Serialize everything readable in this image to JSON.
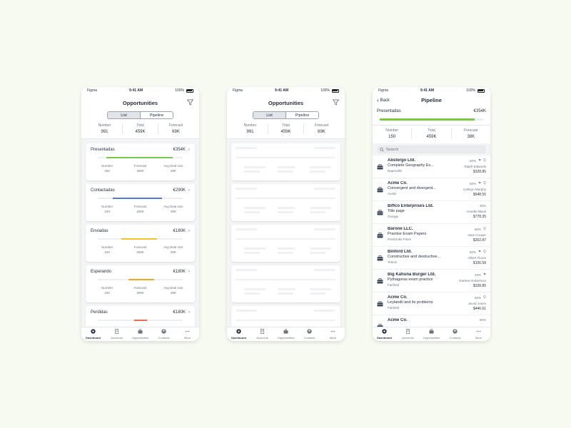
{
  "status": {
    "carrier": "Figma",
    "time": "9:41 AM",
    "battery": "100%"
  },
  "screen1": {
    "title": "Opportunities",
    "segments": [
      "List",
      "Pipeline"
    ],
    "stats": [
      {
        "label": "Number",
        "value": "991"
      },
      {
        "label": "Total",
        "value": "459K"
      },
      {
        "label": "Forecast",
        "value": "69K"
      }
    ],
    "mini_labels": [
      "Number",
      "Forecast",
      "Avg Deal size"
    ],
    "cards": [
      {
        "name": "Presentadas",
        "amount": "€354K",
        "color": "#7ac943",
        "progress": 0.78,
        "offset": 0.1,
        "number": "150",
        "forecast": "459K",
        "avg": "38K"
      },
      {
        "name": "Contactadas",
        "amount": "€290K",
        "color": "#4a7fd4",
        "progress": 0.58,
        "offset": 0.18,
        "number": "150",
        "forecast": "459K",
        "avg": "38K"
      },
      {
        "name": "Enviadas",
        "amount": "€180K",
        "color": "#f2c12e",
        "progress": 0.42,
        "offset": 0.28,
        "number": "150",
        "forecast": "459K",
        "avg": "38K"
      },
      {
        "name": "Esperando",
        "amount": "€180K",
        "color": "#f5a623",
        "progress": 0.3,
        "offset": 0.36,
        "number": "150",
        "forecast": "459K",
        "avg": "38K"
      },
      {
        "name": "Perdidas",
        "amount": "€180K",
        "color": "#f0684b",
        "progress": 0.15,
        "offset": 0.43
      }
    ]
  },
  "screen2": {
    "title": "Opportunities",
    "segments": [
      "List",
      "Pipeline"
    ],
    "stats": [
      {
        "label": "Number",
        "value": "991"
      },
      {
        "label": "Total",
        "value": "459K"
      },
      {
        "label": "Forecast",
        "value": "69K"
      }
    ]
  },
  "screen3": {
    "back": "Back",
    "title": "Pipeline",
    "stage_name": "Presentadas",
    "stage_amount": "€354K",
    "stage_color": "#7ac943",
    "stage_progress": 0.92,
    "stats": [
      {
        "label": "Number",
        "value": "150"
      },
      {
        "label": "Total",
        "value": "459K"
      },
      {
        "label": "Forecast",
        "value": "38K"
      }
    ],
    "search_placeholder": "Search",
    "items": [
      {
        "company": "Abstergo Ltd.",
        "desc": "Complete Geography Ex...",
        "city": "Naperville",
        "pct": "60%",
        "person": "Ralph Edwards",
        "amount": "$328.85",
        "flag": true,
        "pin": true
      },
      {
        "company": "Acme Co.",
        "desc": "Convergent and divergent...",
        "city": "Austin",
        "pct": "60%",
        "person": "Kathryn Murphy",
        "amount": "$948.55",
        "flag": true,
        "pin": true
      },
      {
        "company": "Biffco Enterprises Ltd.",
        "desc": "Title page",
        "city": "Orange",
        "pct": "30%",
        "person": "Annette Black",
        "amount": "$778.35",
        "flag": false,
        "pin": false
      },
      {
        "company": "Barone LLC.",
        "desc": "Practise Exam Papers",
        "city": "Pembroke Pines",
        "pct": "60%",
        "person": "Jane Cooper",
        "amount": "$202.87",
        "flag": false,
        "pin": true
      },
      {
        "company": "Binford Ltd.",
        "desc": "Constructive and destructive...",
        "city": "Toledo",
        "pct": "60%",
        "person": "Albert Flores",
        "amount": "$106.58",
        "flag": true,
        "pin": true
      },
      {
        "company": "Big Kahuna Burger Ltd.",
        "desc": "Pythagoras exam practice",
        "city": "Fairfield",
        "pct": "25%",
        "person": "Darlene Robertson",
        "amount": "$328.85",
        "flag": true,
        "pin": false
      },
      {
        "company": "Acme Co.",
        "desc": "Leylandii and its problems",
        "city": "Fairfield",
        "pct": "60%",
        "person": "Jacob Jones",
        "amount": "$446.61",
        "flag": false,
        "pin": true
      },
      {
        "company": "Acme Co.",
        "desc": "",
        "city": "",
        "pct": "60%",
        "person": "",
        "amount": "",
        "flag": false,
        "pin": false
      }
    ]
  },
  "tabs": [
    "Dashboard",
    "Accounts",
    "Opportunities",
    "Contacts",
    "More"
  ]
}
